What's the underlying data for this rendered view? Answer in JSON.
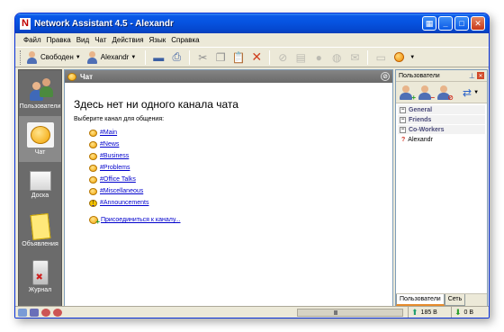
{
  "window": {
    "title": "Network Assistant 4.5 - Alexandr",
    "logo": "N"
  },
  "menu": [
    "Файл",
    "Правка",
    "Вид",
    "Чат",
    "Действия",
    "Язык",
    "Справка"
  ],
  "toolbar": {
    "status_label": "Свободен",
    "user_label": "Alexandr"
  },
  "sidebar": {
    "items": [
      {
        "label": "Пользователи",
        "icon": "users-icon"
      },
      {
        "label": "Чат",
        "icon": "chat-icon"
      },
      {
        "label": "Доска",
        "icon": "board-icon"
      },
      {
        "label": "Объявления",
        "icon": "note-icon"
      },
      {
        "label": "Журнал",
        "icon": "log-icon"
      }
    ]
  },
  "chat": {
    "header": "Чат",
    "title": "Здесь нет ни одного канала чата",
    "subtitle": "Выберите канал для общения:",
    "channels": [
      "#Main",
      "#News",
      "#Business",
      "#Problems",
      "#Office Talks",
      "#Miscellaneous",
      "#Announcements"
    ],
    "join_link": "Присоединиться к каналу..."
  },
  "users_panel": {
    "title": "Пользователи",
    "groups": [
      "General",
      "Friends",
      "Co-Workers"
    ],
    "users": [
      "Alexandr"
    ],
    "tabs": [
      "Пользователи",
      "Сеть"
    ]
  },
  "status": {
    "upload": "185 B",
    "download": "0 B"
  }
}
